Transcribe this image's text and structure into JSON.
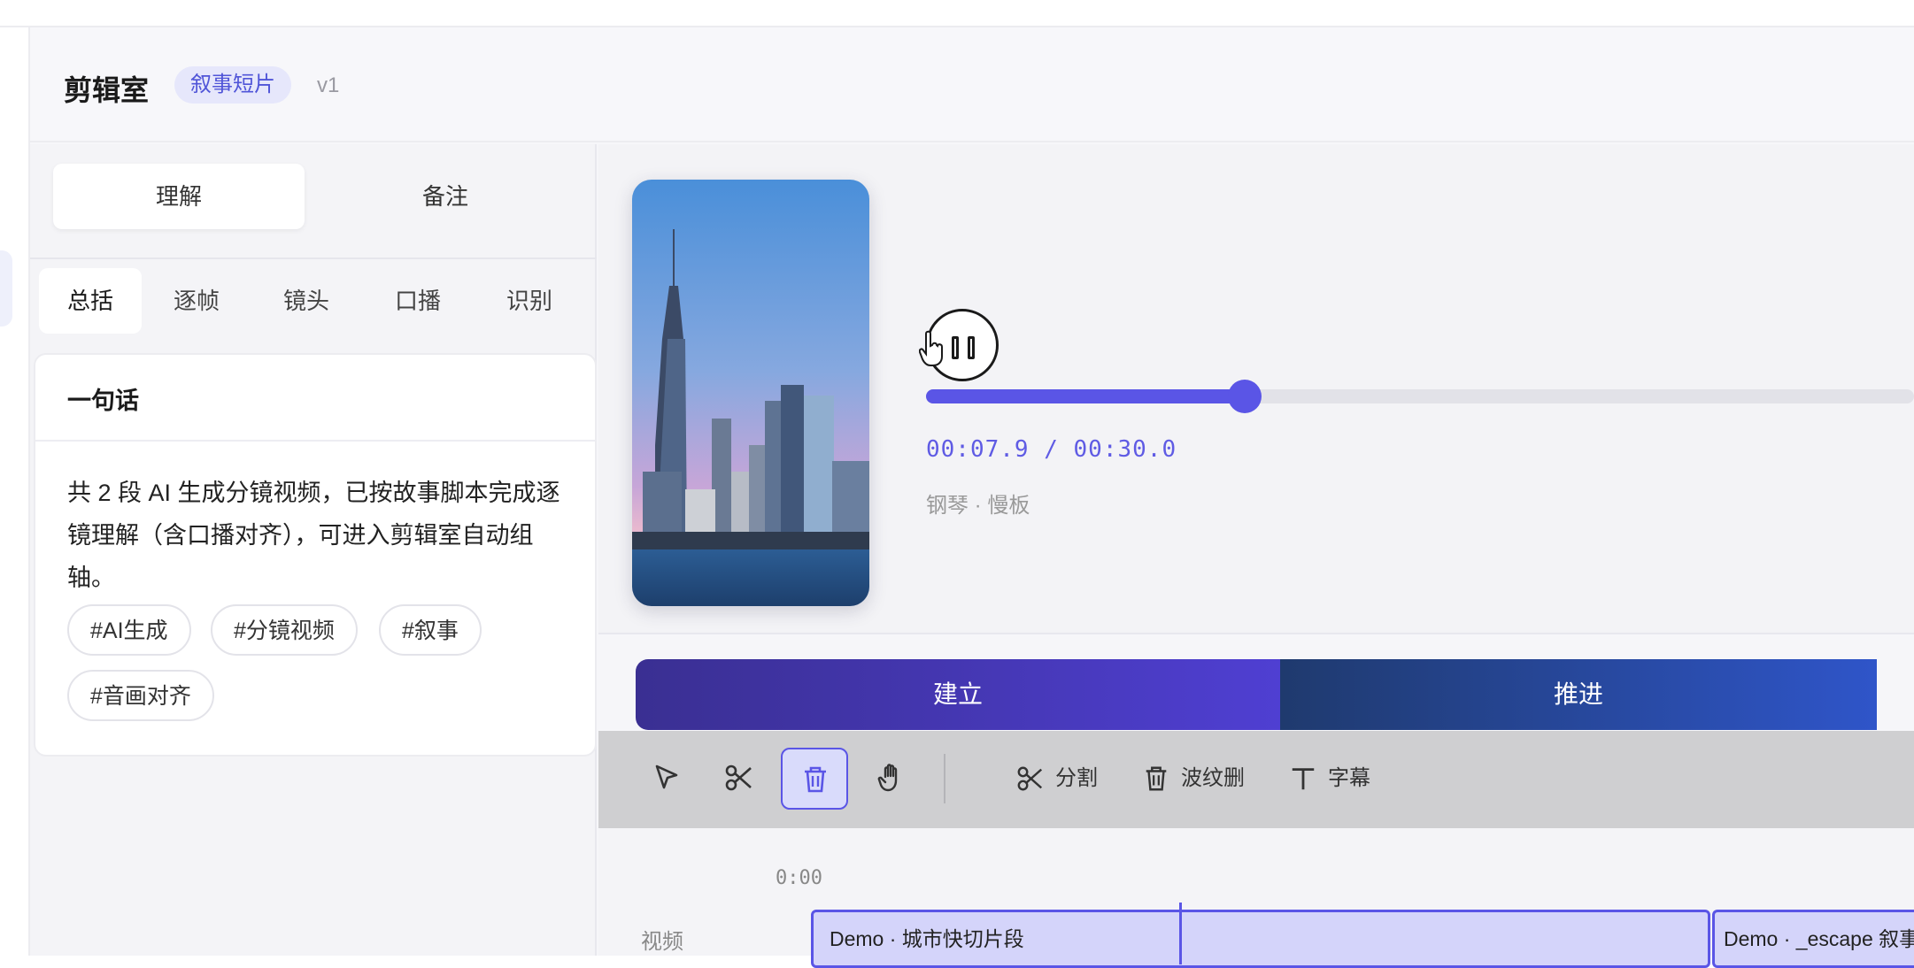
{
  "header": {
    "title": "剪辑室",
    "mode_badge": "叙事短片",
    "version": "v1"
  },
  "left_panel": {
    "segments": [
      "理解",
      "备注"
    ],
    "active_segment": "理解",
    "subtabs": [
      "总括",
      "逐帧",
      "镜头",
      "口播",
      "识别"
    ],
    "active_subtab": "总括",
    "card": {
      "title": "一句话",
      "body": "共 2 段 AI 生成分镜视频，已按故事脚本完成逐镜理解（含口播对齐），可进入剪辑室自动组轴。",
      "tags": [
        "#AI生成",
        "#分镜视频",
        "#叙事",
        "#音画对齐"
      ]
    }
  },
  "player": {
    "thumbnail": "city-skyline-image",
    "pause_icon": "pause-icon",
    "progress_fraction": 0.3226,
    "current_time": "00:07.9",
    "total_time": "00:30.0",
    "timecode": "00:07.9 / 00:30.0",
    "music": "钢琴 · 慢板"
  },
  "phases": [
    {
      "label": "建立"
    },
    {
      "label": "推进"
    }
  ],
  "toolbar": {
    "tools": [
      "select-arrow-icon",
      "scissors-icon",
      "trash-icon",
      "hand-icon"
    ],
    "active_tool": "trash-icon",
    "split_label": "分割",
    "ripple_delete_label": "波纹删",
    "subtitle_label": "字幕"
  },
  "timeline": {
    "time_zero": "0:00",
    "track_label": "视频",
    "clips": [
      {
        "label": "Demo · 城市快切片段"
      },
      {
        "label": "Demo · _escape 叙事段"
      }
    ]
  },
  "colors": {
    "accent": "#5a55e6",
    "badge_bg": "#e6e7fb",
    "phase_a": "#4f3fd2",
    "phase_b": "#2f55c9"
  }
}
